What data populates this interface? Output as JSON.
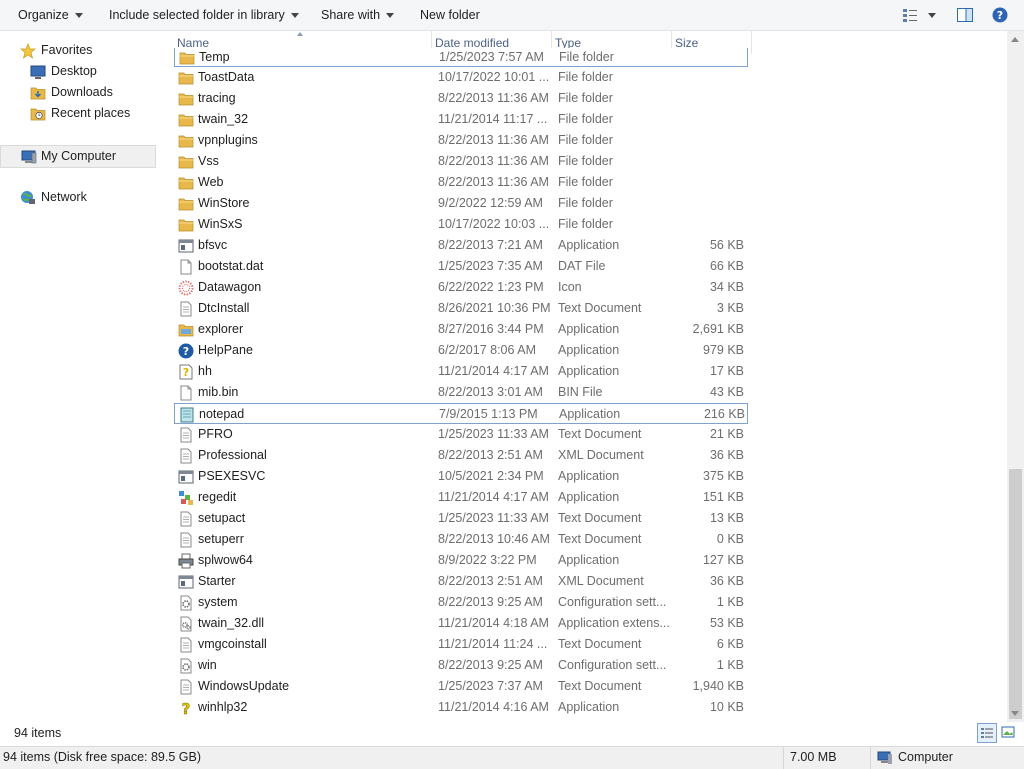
{
  "toolbar": {
    "organize": "Organize",
    "include_library": "Include selected folder in library",
    "share_with": "Share with",
    "new_folder": "New folder",
    "view_icon": "view-options-icon",
    "pane_icon": "preview-pane-icon",
    "help_icon": "help-icon"
  },
  "nav": {
    "favorites": "Favorites",
    "desktop": "Desktop",
    "downloads": "Downloads",
    "recent_places": "Recent places",
    "my_computer": "My Computer",
    "network": "Network"
  },
  "columns": {
    "name": "Name",
    "date_modified": "Date modified",
    "type": "Type",
    "size": "Size"
  },
  "files": [
    {
      "name": "Temp",
      "date": "1/25/2023 7:57 AM",
      "type": "File folder",
      "size": "",
      "icon": "folder",
      "selected": true
    },
    {
      "name": "ToastData",
      "date": "10/17/2022 10:01 ...",
      "type": "File folder",
      "size": "",
      "icon": "folder"
    },
    {
      "name": "tracing",
      "date": "8/22/2013 11:36 AM",
      "type": "File folder",
      "size": "",
      "icon": "folder"
    },
    {
      "name": "twain_32",
      "date": "11/21/2014 11:17 ...",
      "type": "File folder",
      "size": "",
      "icon": "folder"
    },
    {
      "name": "vpnplugins",
      "date": "8/22/2013 11:36 AM",
      "type": "File folder",
      "size": "",
      "icon": "folder"
    },
    {
      "name": "Vss",
      "date": "8/22/2013 11:36 AM",
      "type": "File folder",
      "size": "",
      "icon": "folder"
    },
    {
      "name": "Web",
      "date": "8/22/2013 11:36 AM",
      "type": "File folder",
      "size": "",
      "icon": "folder"
    },
    {
      "name": "WinStore",
      "date": "9/2/2022 12:59 AM",
      "type": "File folder",
      "size": "",
      "icon": "folder"
    },
    {
      "name": "WinSxS",
      "date": "10/17/2022 10:03 ...",
      "type": "File folder",
      "size": "",
      "icon": "folder"
    },
    {
      "name": "bfsvc",
      "date": "8/22/2013 7:21 AM",
      "type": "Application",
      "size": "56 KB",
      "icon": "app"
    },
    {
      "name": "bootstat.dat",
      "date": "1/25/2023 7:35 AM",
      "type": "DAT File",
      "size": "66 KB",
      "icon": "file"
    },
    {
      "name": "Datawagon",
      "date": "6/22/2022 1:23 PM",
      "type": "Icon",
      "size": "34 KB",
      "icon": "pinwheel"
    },
    {
      "name": "DtcInstall",
      "date": "8/26/2021 10:36 PM",
      "type": "Text Document",
      "size": "3 KB",
      "icon": "text"
    },
    {
      "name": "explorer",
      "date": "8/27/2016 3:44 PM",
      "type": "Application",
      "size": "2,691 KB",
      "icon": "explorer"
    },
    {
      "name": "HelpPane",
      "date": "6/2/2017 8:06 AM",
      "type": "Application",
      "size": "979 KB",
      "icon": "help"
    },
    {
      "name": "hh",
      "date": "11/21/2014 4:17 AM",
      "type": "Application",
      "size": "17 KB",
      "icon": "hh"
    },
    {
      "name": "mib.bin",
      "date": "8/22/2013 3:01 AM",
      "type": "BIN File",
      "size": "43 KB",
      "icon": "file"
    },
    {
      "name": "notepad",
      "date": "7/9/2015 1:13 PM",
      "type": "Application",
      "size": "216 KB",
      "icon": "notepad",
      "selected": true
    },
    {
      "name": "PFRO",
      "date": "1/25/2023 11:33 AM",
      "type": "Text Document",
      "size": "21 KB",
      "icon": "text"
    },
    {
      "name": "Professional",
      "date": "8/22/2013 2:51 AM",
      "type": "XML Document",
      "size": "36 KB",
      "icon": "text"
    },
    {
      "name": "PSEXESVC",
      "date": "10/5/2021 2:34 PM",
      "type": "Application",
      "size": "375 KB",
      "icon": "app"
    },
    {
      "name": "regedit",
      "date": "11/21/2014 4:17 AM",
      "type": "Application",
      "size": "151 KB",
      "icon": "regedit"
    },
    {
      "name": "setupact",
      "date": "1/25/2023 11:33 AM",
      "type": "Text Document",
      "size": "13 KB",
      "icon": "text"
    },
    {
      "name": "setuperr",
      "date": "8/22/2013 10:46 AM",
      "type": "Text Document",
      "size": "0 KB",
      "icon": "text"
    },
    {
      "name": "splwow64",
      "date": "8/9/2022 3:22 PM",
      "type": "Application",
      "size": "127 KB",
      "icon": "printer"
    },
    {
      "name": "Starter",
      "date": "8/22/2013 2:51 AM",
      "type": "XML Document",
      "size": "36 KB",
      "icon": "app"
    },
    {
      "name": "system",
      "date": "8/22/2013 9:25 AM",
      "type": "Configuration sett...",
      "size": "1 KB",
      "icon": "config"
    },
    {
      "name": "twain_32.dll",
      "date": "11/21/2014 4:18 AM",
      "type": "Application extens...",
      "size": "53 KB",
      "icon": "dll"
    },
    {
      "name": "vmgcoinstall",
      "date": "11/21/2014 11:24 ...",
      "type": "Text Document",
      "size": "6 KB",
      "icon": "text"
    },
    {
      "name": "win",
      "date": "8/22/2013 9:25 AM",
      "type": "Configuration sett...",
      "size": "1 KB",
      "icon": "config"
    },
    {
      "name": "WindowsUpdate",
      "date": "1/25/2023 7:37 AM",
      "type": "Text Document",
      "size": "1,940 KB",
      "icon": "text"
    },
    {
      "name": "winhlp32",
      "date": "11/21/2014 4:16 AM",
      "type": "Application",
      "size": "10 KB",
      "icon": "winhlp"
    }
  ],
  "footer": {
    "item_count": "94 items"
  },
  "status": {
    "summary": "94 items (Disk free space: 89.5 GB)",
    "size": "7.00 MB",
    "location": "Computer"
  },
  "colors": {
    "folder": "#e8b94a",
    "selection_border": "#7da2ce",
    "header_text": "#4d6185",
    "secondary_text": "#6d6d6d"
  }
}
